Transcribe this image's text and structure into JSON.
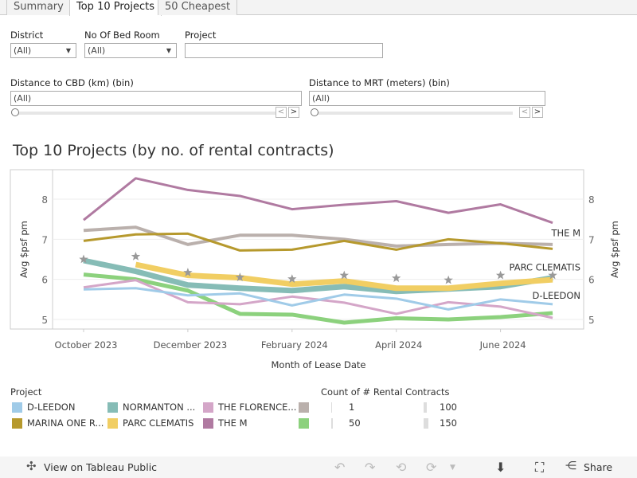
{
  "tabs": [
    {
      "label": "Summary"
    },
    {
      "label": "Top 10 Projects",
      "active": true
    },
    {
      "label": "50 Cheapest"
    }
  ],
  "filters": {
    "district": {
      "label": "District",
      "value": "(All)"
    },
    "bedroom": {
      "label": "No Of Bed Room",
      "value": "(All)"
    },
    "project": {
      "label": "Project",
      "value": ""
    },
    "cbd": {
      "label": "Distance to CBD (km) (bin)",
      "value": "(All)"
    },
    "mrt": {
      "label": "Distance to MRT (meters) (bin)",
      "value": "(All)"
    }
  },
  "chart_title": "Top 10 Projects (by no. of rental contracts)",
  "chart_data": {
    "type": "line",
    "x": [
      "Oct 2023",
      "Nov 2023",
      "Dec 2023",
      "Jan 2024",
      "Feb 2024",
      "Mar 2024",
      "Apr 2024",
      "May 2024",
      "Jun 2024",
      "Jul 2024"
    ],
    "x_tick_labels": [
      "October 2023",
      "December 2023",
      "February 2024",
      "April 2024",
      "June 2024"
    ],
    "xlabel": "Month of Lease Date",
    "ylabel": "Avg $psf pm",
    "ylabel_right": "Avg $psf pm",
    "y_ticks": [
      5,
      6,
      7,
      8
    ],
    "ylim": [
      4.75,
      8.75
    ],
    "grid": true,
    "size_legend_title": "Count of # Rental Contracts",
    "size_legend": [
      1,
      50,
      100,
      150
    ],
    "series": [
      {
        "name": "THE M",
        "color": "#b07aa1",
        "width": 3,
        "end_label": "THE M",
        "values": [
          7.48,
          8.52,
          8.23,
          8.08,
          7.75,
          7.86,
          7.95,
          7.66,
          7.87,
          7.41
        ]
      },
      {
        "name": "",
        "color": "#bab0ac",
        "width": 4,
        "values": [
          7.22,
          7.3,
          6.87,
          7.1,
          7.1,
          7.0,
          6.83,
          6.87,
          6.9,
          6.87
        ]
      },
      {
        "name": "MARINA ONE R...",
        "color": "#b6992d",
        "width": 3,
        "values": [
          6.96,
          7.12,
          7.14,
          6.72,
          6.74,
          6.96,
          6.74,
          7.0,
          6.9,
          6.76
        ]
      },
      {
        "name": "NORMANTON ...",
        "color": "#86bcb6",
        "width": 7,
        "values": [
          6.47,
          6.2,
          5.86,
          5.78,
          5.72,
          5.82,
          5.7,
          5.76,
          5.82,
          6.04
        ]
      },
      {
        "name": "PARC CLEMATIS",
        "color": "#f1ce63",
        "width": 7,
        "end_label": "PARC CLEMATIS",
        "values": [
          null,
          6.37,
          6.1,
          6.04,
          5.88,
          5.96,
          5.78,
          5.78,
          5.9,
          5.99
        ]
      },
      {
        "name": "",
        "color": "#8cd17d",
        "width": 5,
        "values": [
          6.12,
          6.0,
          5.72,
          5.14,
          5.12,
          4.92,
          5.03,
          5.0,
          5.06,
          5.16
        ]
      },
      {
        "name": "THE FLORENCE...",
        "color": "#d4a6c8",
        "width": 3,
        "values": [
          5.8,
          5.98,
          5.43,
          5.38,
          5.57,
          5.42,
          5.14,
          5.43,
          5.32,
          5.04
        ]
      },
      {
        "name": "D-LEEDON",
        "color": "#a0cbe8",
        "width": 3,
        "end_label": "D-LEEDON",
        "values": [
          5.75,
          5.78,
          5.6,
          5.65,
          5.35,
          5.62,
          5.52,
          5.25,
          5.5,
          5.38
        ]
      }
    ],
    "reference_marks": {
      "shape": "star",
      "color": "#999999",
      "values": [
        6.5,
        6.57,
        6.17,
        6.05,
        6.01,
        6.1,
        6.03,
        5.98,
        6.1,
        6.1
      ]
    }
  },
  "legend": {
    "title": "Project",
    "items": [
      {
        "label": "D-LEEDON",
        "color": "#a0cbe8"
      },
      {
        "label": "MARINA ONE R...",
        "color": "#b6992d"
      },
      {
        "label": "NORMANTON ...",
        "color": "#86bcb6"
      },
      {
        "label": "PARC CLEMATIS",
        "color": "#f1ce63"
      },
      {
        "label": "THE FLORENCE...",
        "color": "#d4a6c8"
      },
      {
        "label": "THE M",
        "color": "#b07aa1"
      },
      {
        "label": "",
        "color": "#bab0ac"
      },
      {
        "label": "",
        "color": "#8cd17d"
      }
    ]
  },
  "footer": {
    "view_label": "View on Tableau Public",
    "share_label": "Share"
  }
}
